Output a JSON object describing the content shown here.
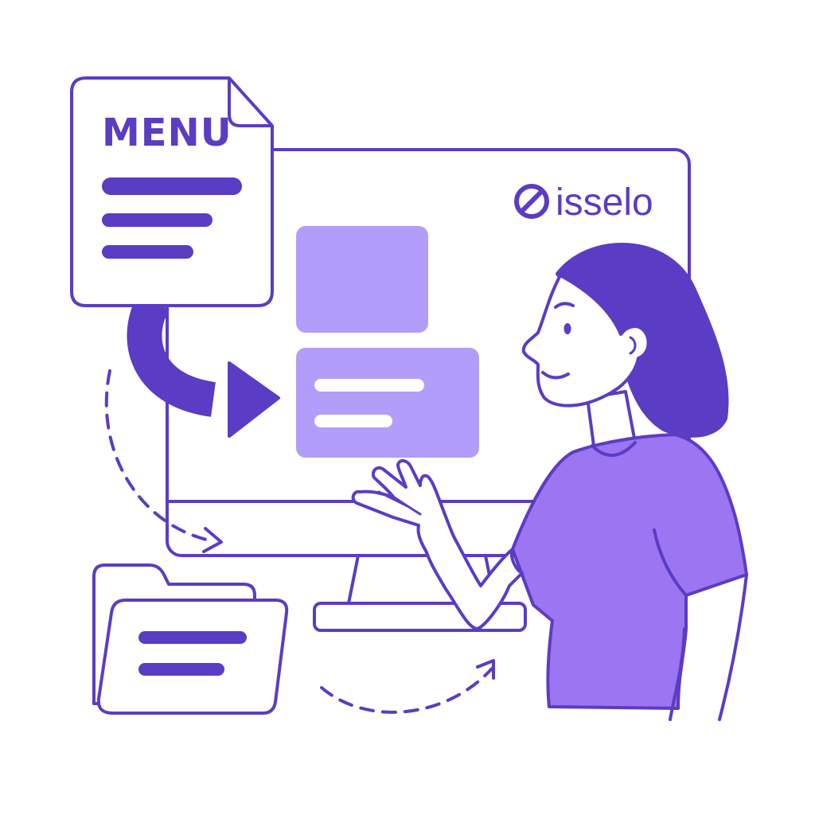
{
  "menu_document": {
    "title": "MENU"
  },
  "brand": {
    "name": "isselo",
    "icon": "slashed-circle-logo-icon"
  },
  "colors": {
    "outline": "#5B3CC4",
    "accent_light": "#B39DFA",
    "shirt": "#9B75F2",
    "hair": "#5B3CC4",
    "line_bar": "#5B3CC4",
    "white": "#ffffff"
  }
}
